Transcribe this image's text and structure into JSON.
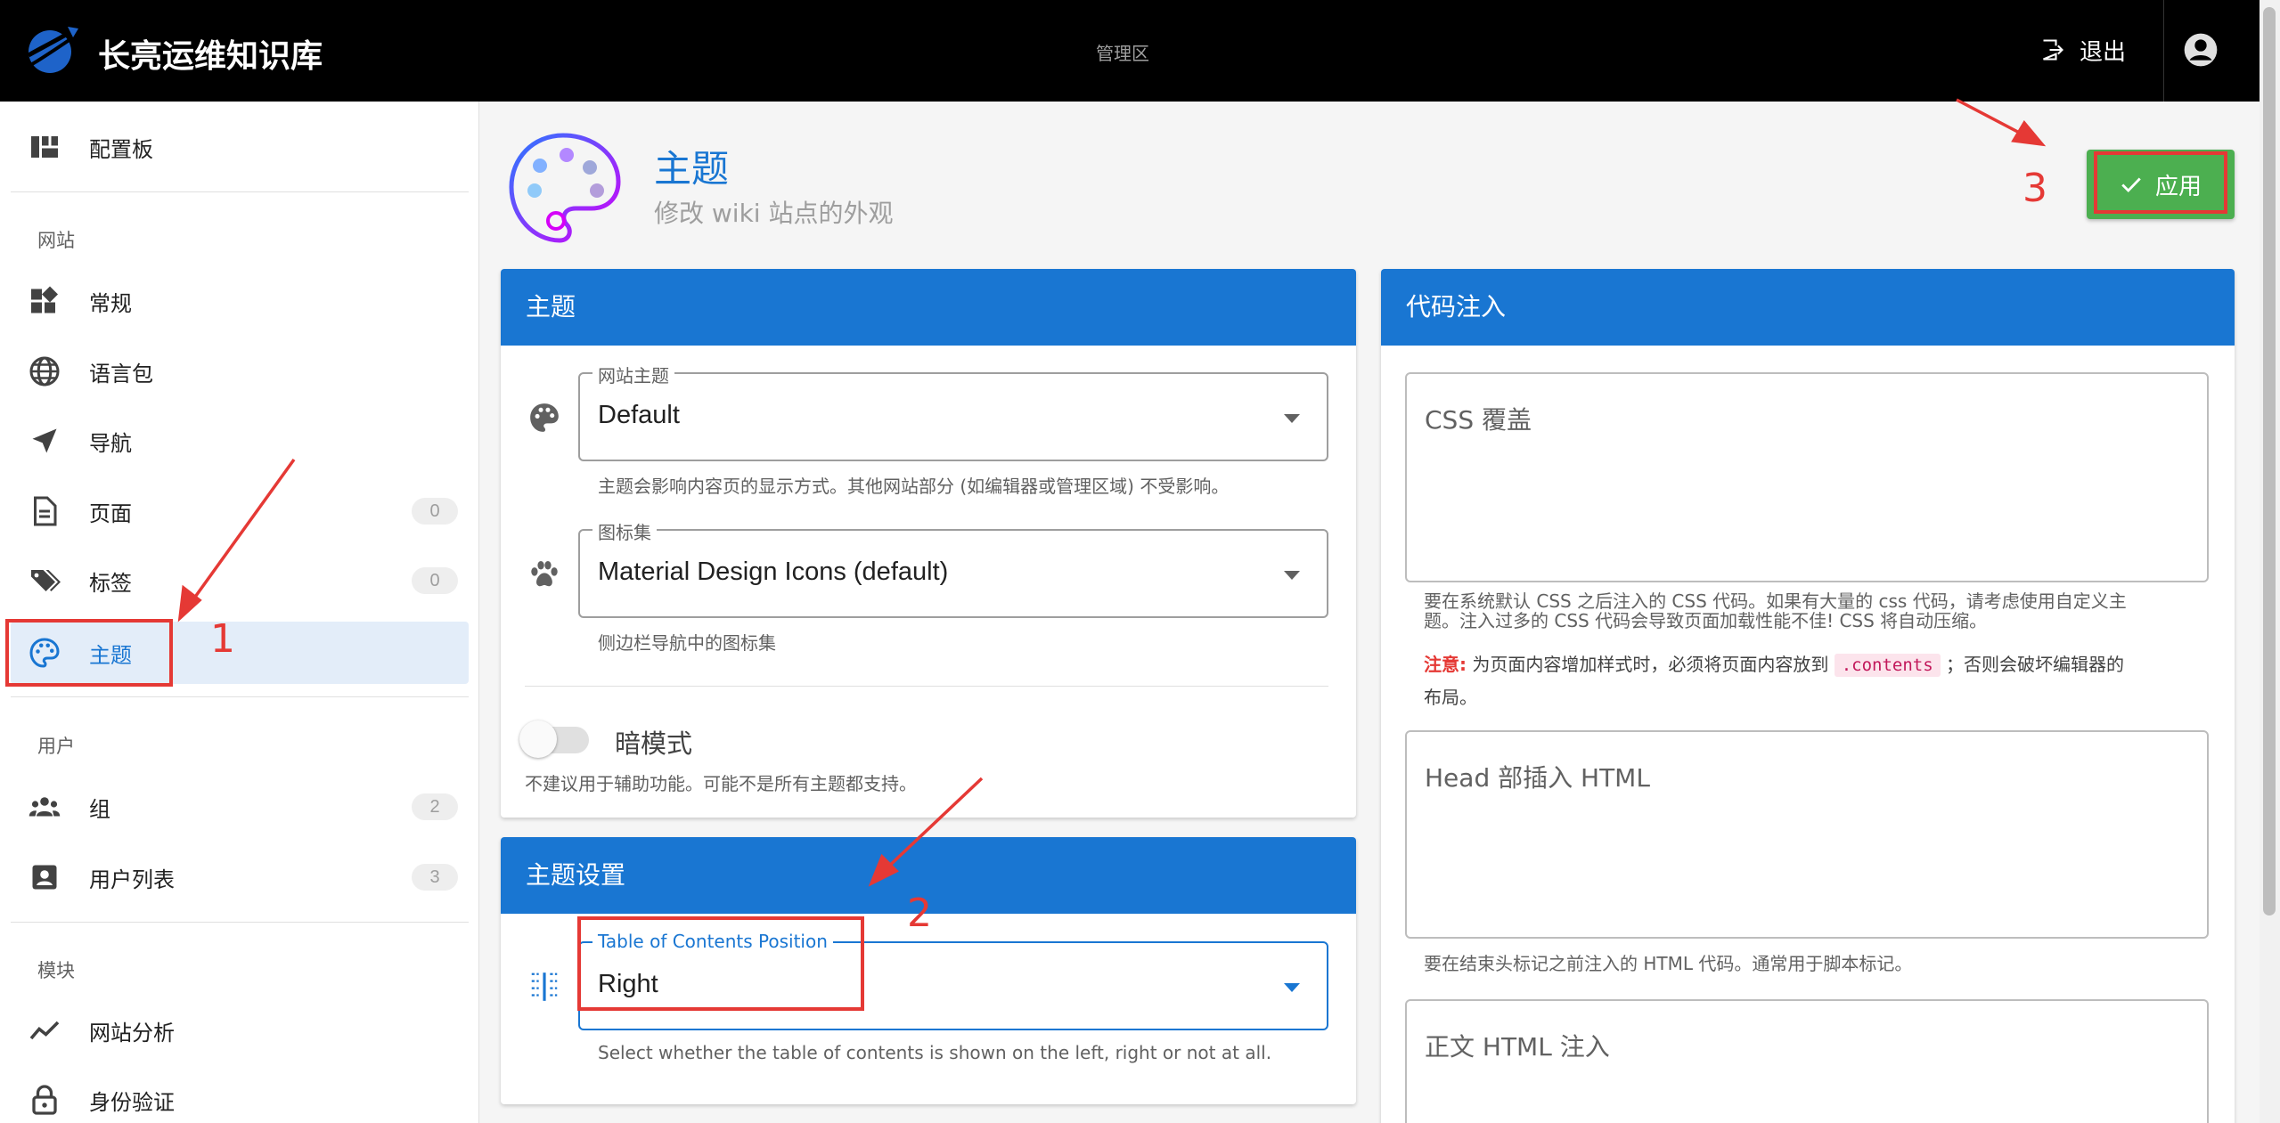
{
  "app": {
    "title": "长亮运维知识库",
    "area_label": "管理区",
    "logout_label": "退出"
  },
  "sidebar": {
    "dashboard": "配置板",
    "sections": {
      "website": "网站",
      "users": "用户",
      "modules": "模块"
    },
    "website_items": [
      {
        "label": "常规"
      },
      {
        "label": "语言包"
      },
      {
        "label": "导航"
      },
      {
        "label": "页面",
        "count": "0"
      },
      {
        "label": "标签",
        "count": "0"
      },
      {
        "label": "主题"
      }
    ],
    "user_items": [
      {
        "label": "组",
        "count": "2"
      },
      {
        "label": "用户列表",
        "count": "3"
      }
    ],
    "module_items": [
      {
        "label": "网站分析"
      },
      {
        "label": "身份验证"
      }
    ]
  },
  "header": {
    "title": "主题",
    "subtitle": "修改 wiki 站点的外观",
    "apply_label": "应用"
  },
  "theme_card": {
    "title": "主题",
    "site_theme": {
      "legend": "网站主题",
      "value": "Default",
      "hint": "主题会影响内容页的显示方式。其他网站部分 (如编辑器或管理区域) 不受影响。"
    },
    "icon_set": {
      "legend": "图标集",
      "value": "Material Design Icons (default)",
      "hint": "侧边栏导航中的图标集"
    },
    "dark_mode": {
      "label": "暗模式",
      "hint": "不建议用于辅助功能。可能不是所有主题都支持。",
      "enabled": false
    }
  },
  "theme_settings_card": {
    "title": "主题设置",
    "toc": {
      "legend": "Table of Contents Position",
      "value": "Right",
      "hint": "Select whether the table of contents is shown on the left, right or not at all."
    }
  },
  "code_card": {
    "title": "代码注入",
    "css": {
      "placeholder": "CSS 覆盖",
      "hint_line1": "要在系统默认 CSS 之后注入的 CSS 代码。如果有大量的 css 代码，请考虑使用自定义主",
      "hint_line2": "题。注入过多的 CSS 代码会导致页面加载性能不佳! CSS 将自动压缩。",
      "note_label": "注意:",
      "note_text": "为页面内容增加样式时，必须将页面内容放到",
      "note_code": ".contents",
      "note_after": "；否则会破坏编辑器的",
      "note_line2": "布局。"
    },
    "head": {
      "placeholder": "Head 部插入 HTML",
      "hint": "要在结束头标记之前注入的 HTML 代码。通常用于脚本标记。"
    },
    "body": {
      "placeholder": "正文 HTML 注入"
    }
  },
  "annotations": [
    "1",
    "2",
    "3"
  ],
  "colors": {
    "primary": "#1976d2",
    "apply": "#4caf50",
    "annotation": "#e53935",
    "topbar": "#000000"
  }
}
